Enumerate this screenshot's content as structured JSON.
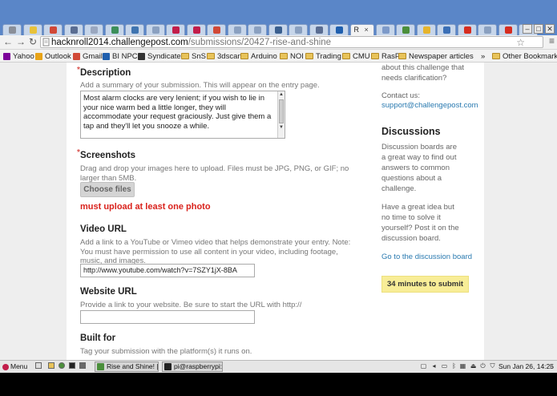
{
  "browser": {
    "tabs": [
      {
        "icon": "raspberry-pi-icon",
        "color": "#8a8f99"
      },
      {
        "icon": "lightbulb-icon",
        "color": "#e8c23a"
      },
      {
        "icon": "gmail-icon",
        "color": "#d14836"
      },
      {
        "icon": "page-icon",
        "color": "#5a6d92"
      },
      {
        "icon": "document-icon",
        "color": "#9aa7bf"
      },
      {
        "icon": "globe-icon",
        "color": "#3c8f5a"
      },
      {
        "icon": "python-icon",
        "color": "#3f74b0"
      },
      {
        "icon": "page-icon",
        "color": "#8aa0c0"
      },
      {
        "icon": "raspberry-icon",
        "color": "#c21d4a"
      },
      {
        "icon": "raspberry-icon",
        "color": "#c21d4a"
      },
      {
        "icon": "gmail-icon",
        "color": "#d14836"
      },
      {
        "icon": "page-icon",
        "color": "#8aa0c0"
      },
      {
        "icon": "page-icon",
        "color": "#8aa0c0"
      },
      {
        "icon": "wordpress-icon",
        "color": "#3a5f8f"
      },
      {
        "icon": "page-icon",
        "color": "#8aa0c0"
      },
      {
        "icon": "page-icon",
        "color": "#5a6d92"
      },
      {
        "icon": "outlook-icon",
        "color": "#1f5fae"
      },
      {
        "icon": "challengepost-icon",
        "color": "#8aa0c0",
        "active": true,
        "title": "R"
      },
      {
        "icon": "puzzle-icon",
        "color": "#7d9ac9"
      },
      {
        "icon": "chrome-icon",
        "color": "#4b8f3b"
      },
      {
        "icon": "drive-icon",
        "color": "#e6b42d"
      },
      {
        "icon": "chat-icon",
        "color": "#3b6fb6"
      },
      {
        "icon": "youtube-icon",
        "color": "#d62d20"
      },
      {
        "icon": "page-icon",
        "color": "#8aa0c0"
      },
      {
        "icon": "youtube-icon",
        "color": "#d62d20"
      },
      {
        "icon": "google-icon",
        "color": "#4a7bd0"
      }
    ],
    "active_tab_title": "R",
    "url_host": "hacknroll2014.challengepost.com",
    "url_path": "/submissions/20427-rise-and-shine",
    "bookmarks": [
      {
        "label": "Yahoo",
        "icon": "yahoo-icon",
        "color": "#7b0099"
      },
      {
        "label": "Outlook",
        "icon": "outlook-icon",
        "color": "#e8a317"
      },
      {
        "label": "Gmail",
        "icon": "gmail-icon",
        "color": "#d14836"
      },
      {
        "label": "BI NPC",
        "icon": "bi-icon",
        "color": "#1f5fae"
      },
      {
        "label": "Syndicate",
        "icon": "syndicate-icon",
        "color": "#333333"
      },
      {
        "label": "SnS",
        "icon": "folder-icon",
        "color": "#e8c35a"
      },
      {
        "label": "3dscan",
        "icon": "folder-icon",
        "color": "#e8c35a"
      },
      {
        "label": "Arduino",
        "icon": "folder-icon",
        "color": "#e8c35a"
      },
      {
        "label": "NOI",
        "icon": "folder-icon",
        "color": "#e8c35a"
      },
      {
        "label": "Trading",
        "icon": "folder-icon",
        "color": "#e8c35a"
      },
      {
        "label": "CMU",
        "icon": "folder-icon",
        "color": "#e8c35a"
      },
      {
        "label": "RasPi",
        "icon": "folder-icon",
        "color": "#e8c35a"
      },
      {
        "label": "Newspaper articles",
        "icon": "folder-icon",
        "color": "#e8c35a"
      }
    ],
    "overflow_chevron": "»",
    "other_bookmarks": "Other Bookmarks"
  },
  "form": {
    "description": {
      "title": "Description",
      "help": "Add a summary of your submission. This will appear on the entry page.",
      "value": "Most alarm clocks are very lenient; if you wish to lie in your nice warm bed a little longer, they will accommodate your request graciously. Just give them a tap and they'll let you snooze a while.\n\nThis alarm clock is different. This alarm clock believes in"
    },
    "screenshots": {
      "title": "Screenshots",
      "help": "Drag and drop your images here to upload. Files must be JPG, PNG, or GIF; no larger than 5MB.",
      "button": "Choose files",
      "error": "must upload at least one photo"
    },
    "video": {
      "title": "Video URL",
      "help": "Add a link to a YouTube or Vimeo video that helps demonstrate your entry. Note: You must have permission to use all content in your video, including footage, music, and images.",
      "value": "http://www.youtube.com/watch?v=7SZY1jX-8BA"
    },
    "website": {
      "title": "Website URL",
      "help": "Provide a link to your website. Be sure to start the URL with http://",
      "value": ""
    },
    "built_for": {
      "title": "Built for",
      "help": "Tag your submission with the platform(s) it runs on."
    },
    "required_mark": "*"
  },
  "sidebar": {
    "question_text": "about this challenge that needs clarification?",
    "contact_label": "Contact us:",
    "contact_email": "support@challengepost.com",
    "discussions_title": "Discussions",
    "discussions_text": "Discussion boards are a great way to find out answers to common questions about a challenge.",
    "idea_text": "Have a great idea but no time to solve it yourself? Post it on the discussion board.",
    "discussion_link": "Go to the discussion board",
    "timer": "34 minutes to submit"
  },
  "taskbar": {
    "menu_label": "Menu",
    "windows": [
      {
        "label": "Rise and Shine! | H...",
        "icon": "chrome-icon",
        "color": "#4b8f3b"
      },
      {
        "label": "pi@raspberrypi: ~",
        "icon": "terminal-icon",
        "color": "#222222"
      }
    ],
    "clock": "Sun Jan 26, 14:25"
  }
}
